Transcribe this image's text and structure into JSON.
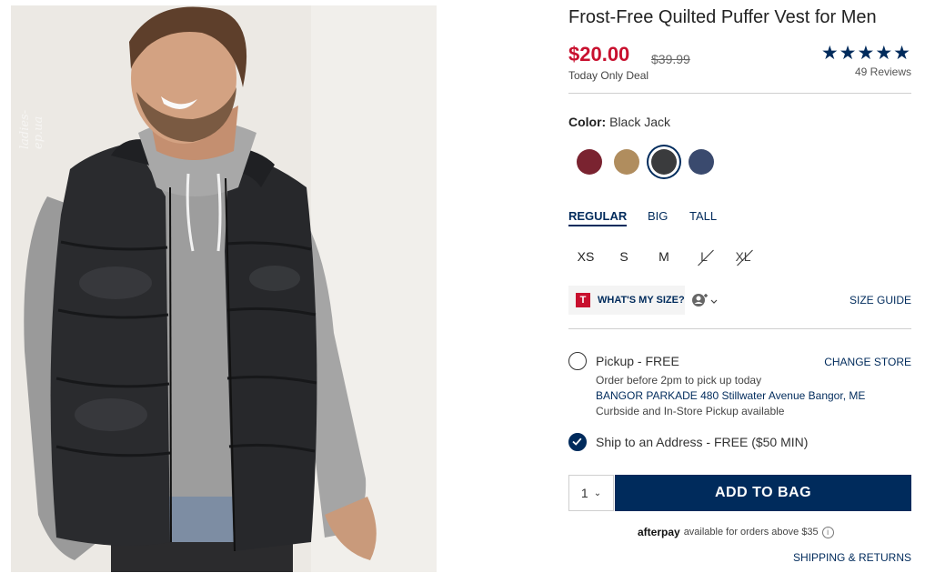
{
  "product": {
    "title": "Frost-Free Quilted Puffer Vest for Men",
    "price": "$20.00",
    "original_price": "$39.99",
    "deal_label": "Today Only Deal",
    "rating_stars": "★★★★★",
    "reviews": "49 Reviews",
    "photo_watermark": "ladies-ep.ua"
  },
  "color": {
    "label": "Color:",
    "selected": "Black Jack",
    "swatches": [
      {
        "name": "burgundy",
        "hex": "#7a2330"
      },
      {
        "name": "tan",
        "hex": "#b08d5e"
      },
      {
        "name": "black-jack",
        "hex": "#3a3b3d"
      },
      {
        "name": "navy",
        "hex": "#3a4a6e"
      }
    ]
  },
  "fit_tabs": [
    "REGULAR",
    "BIG",
    "TALL"
  ],
  "sizes": [
    {
      "label": "XS",
      "available": true
    },
    {
      "label": "S",
      "available": true
    },
    {
      "label": "M",
      "available": true
    },
    {
      "label": "L",
      "available": false
    },
    {
      "label": "XL",
      "available": false
    }
  ],
  "size_help": {
    "logo": "T",
    "whats_my_size": "WHAT'S MY SIZE?",
    "size_guide": "SIZE GUIDE"
  },
  "fulfillment": {
    "pickup_label": "Pickup - FREE",
    "change_store": "CHANGE STORE",
    "pickup_note": "Order before 2pm to pick up today",
    "store": "BANGOR PARKADE 480 Stillwater Avenue  Bangor, ME",
    "curbside": "Curbside and In-Store Pickup available",
    "ship_label": "Ship to an Address - FREE ($50 MIN)"
  },
  "cart": {
    "quantity": "1",
    "add_to_bag": "ADD TO BAG"
  },
  "afterpay": {
    "brand": "afterpay",
    "text": "available for orders above $35"
  },
  "shipping_returns": "SHIPPING & RETURNS",
  "colors": {
    "navy": "#002b5c",
    "sale_red": "#c8102e"
  }
}
